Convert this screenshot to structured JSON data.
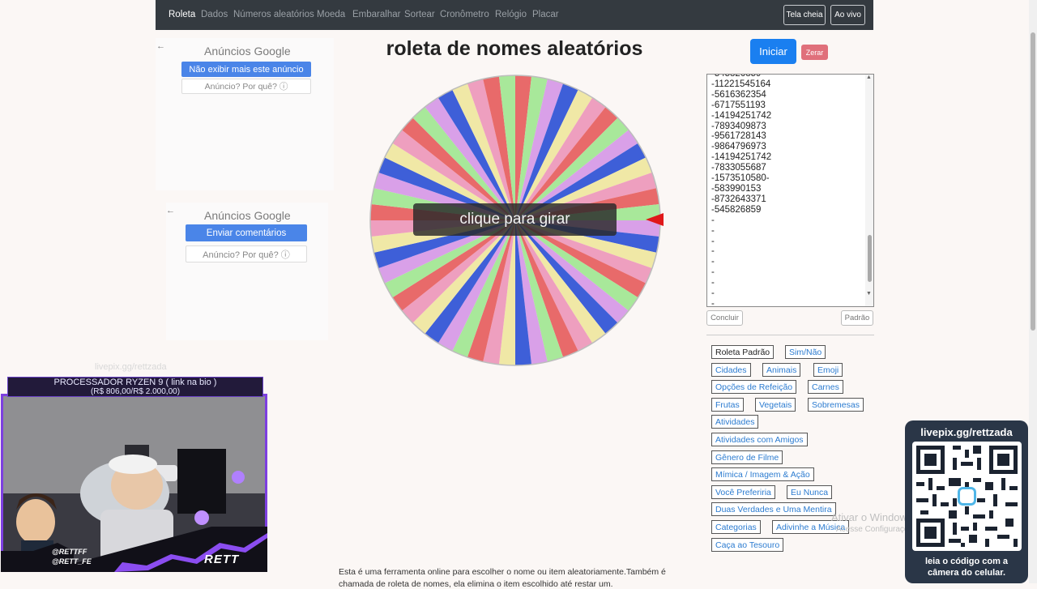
{
  "nav": {
    "items": [
      "Roleta",
      "Dados",
      "Números aleatórios",
      "Moeda",
      "Embaralhar",
      "Sortear",
      "Cronômetro",
      "Relógio",
      "Placar"
    ],
    "fullscreen": "Tela cheia",
    "live": "Ao vivo"
  },
  "ads": [
    {
      "title": "Anúncios Google",
      "hide_button": "Não exibir mais este anúncio",
      "why": "Anúncio? Por quê? ⓘ"
    },
    {
      "title": "Anúncios Google",
      "feedback_button": "Enviar comentários",
      "why": "Anúncio? Por quê? ⓘ"
    }
  ],
  "title": "roleta de nomes aleatórios",
  "wheel": {
    "spin_label": "clique para girar",
    "segments": 56,
    "colors": [
      "#e86a6a",
      "#a8e89a",
      "#d9a0e8",
      "#3e5fd8",
      "#f0e8a6",
      "#ee9fbf"
    ],
    "pointer_color": "#e0181a"
  },
  "controls": {
    "start": "Iniciar",
    "reset": "Zerar",
    "conclude": "Concluir",
    "default": "Padrão"
  },
  "names_text": "-545826859\n-11221545164\n-5616362354\n-6717551193\n-14194251742\n-7893409873\n-9561728143\n-9864796973\n-14194251742\n-7833055687\n-1573510580-\n-583990153\n-8732643371\n-545826859\n-\n-\n-\n-\n-\n-\n-\n-\n-\n-",
  "presets": [
    "Roleta Padrão",
    "Sim/Não",
    "Cidades",
    "Animais",
    "Emoji",
    "Opções de Refeição",
    "Carnes",
    "Frutas",
    "Vegetais",
    "Sobremesas",
    "Atividades",
    "Atividades com Amigos",
    "Gênero de Filme",
    "Mímica / Imagem & Ação",
    "Você Preferiria",
    "Eu Nunca",
    "Duas Verdades e Uma Mentira",
    "Categorias",
    "Adivinhe a Música",
    "Caça ao Tesouro"
  ],
  "windows": {
    "line1": "Ativar o Windows",
    "line2": "Acesse Configurações"
  },
  "qr": {
    "url": "livepix.gg/rettzada",
    "caption1": "leia o código com a",
    "caption2": "câmera do celular."
  },
  "stream": {
    "url": "livepix.gg/rettzada",
    "banner1": "PROCESSADOR RYZEN 9 ( link na bio )",
    "banner2": "(R$ 806,00/R$ 2.000,00)",
    "handle1": "@RETTFF",
    "handle2": "@RETT_FE",
    "logo": "RETT"
  },
  "description": {
    "line1": "Esta é uma ferramenta online para escolher o nome ou item aleatoriamente.Também é",
    "line2": "chamada de roleta de nomes, ela elimina o item escolhido até restar um."
  }
}
